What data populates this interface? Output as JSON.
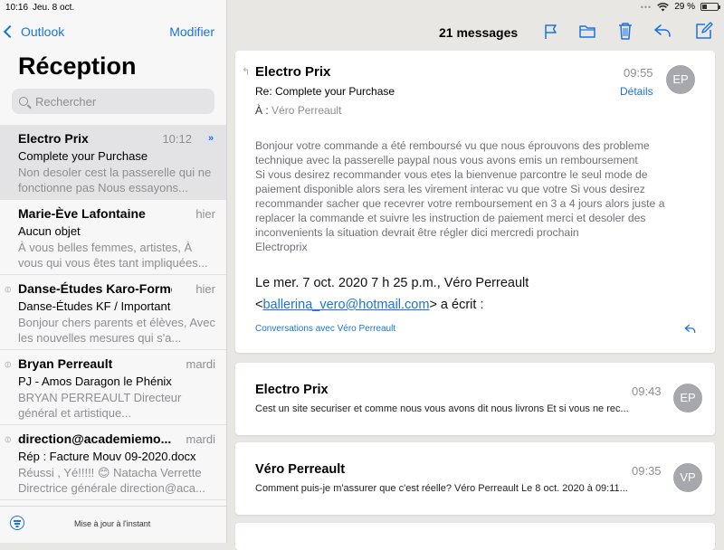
{
  "status_bar": {
    "time": "10:16",
    "date": "Jeu. 8 oct.",
    "battery": "29 %",
    "battery_fraction": 0.29
  },
  "sidebar": {
    "back_label": "Outlook",
    "edit_label": "Modifier",
    "title": "Réception",
    "search_placeholder": "Rechercher",
    "items": [
      {
        "sender": "Electro Prix",
        "time": "10:12",
        "subject": "Complete your Purchase",
        "preview": "Non desoler cest la passerelle qui ne fonctionne pas Nous essayons...",
        "selected": true,
        "attachment": false
      },
      {
        "sender": "Marie-Ève Lafontaine",
        "time": "hier",
        "subject": "Aucun objet",
        "preview": "À vous belles femmes, artistes, À vous qui vous êtes tant impliquées...",
        "selected": false,
        "attachment": false
      },
      {
        "sender": "Danse-Études Karo-Forme",
        "time": "hier",
        "subject": "Danse-Études KF / Important",
        "preview": "Bonjour chers parents et élèves, Avec les nouvelles mesures qui s'a...",
        "selected": false,
        "attachment": true
      },
      {
        "sender": "Bryan Perreault",
        "time": "mardi",
        "subject": "PJ - Amos Daragon le Phénix",
        "preview": "BRYAN PERREAULT Directeur général et artistique...",
        "selected": false,
        "attachment": true
      },
      {
        "sender": "direction@academiemo...",
        "time": "mardi",
        "subject": "Rép : Facture Mouv 09-2020.docx",
        "preview": "Réussi , Yé!!!!! 😊 Natacha Verrette Directrice générale direction@aca...",
        "selected": false,
        "attachment": true
      }
    ],
    "footer_status": "Mise à jour à l'instant"
  },
  "toolbar": {
    "message_count": "21 messages"
  },
  "thread": {
    "main": {
      "sender": "Electro Prix",
      "time": "09:55",
      "subject": "Re: Complete your Purchase",
      "details_label": "Détails",
      "to_label": "À :",
      "to_value": "Véro Perreault",
      "avatar": "EP",
      "body_lines": [
        "Bonjour votre commande a été  remboursé vu que nous éprouvons des probleme",
        "technique avec la passerelle paypal nous vous avons emis un remboursement",
        "Si vous desirez recommander vous etes la bienvenue parcontre le seul mode de",
        "paiement disponible alors sera les virement interac vu que votre Si vous desirez",
        "recommander sacher que recevrer votre remboursement en 3 a 4 jours alors juste a",
        "replacer la commande et suivre les instruction de paiement merci et desoler des",
        "inconvenients la situation devrait être régler dici mercredi prochain",
        "Electroprix"
      ],
      "quote_line1": "Le mer. 7 oct. 2020 7 h 25 p.m., Véro Perreault",
      "quote_open": "<",
      "quote_email": "ballerina_vero@hotmail.com",
      "quote_close": "> a écrit :",
      "conversations_label": "Conversations avec Véro Perreault"
    },
    "others": [
      {
        "sender": "Electro Prix",
        "time": "09:43",
        "avatar": "EP",
        "preview": "Cest un site securiser et comme nous vous avons dit nous livrons Et si vous ne rec..."
      },
      {
        "sender": "Véro Perreault",
        "time": "09:35",
        "avatar": "VP",
        "preview": "Comment puis-je m'assurer que c'est réelle? Véro Perreault Le 8 oct. 2020 à 09:11..."
      }
    ]
  },
  "colors": {
    "accent": "#1a73d9",
    "avatar": "#a7a8ad"
  }
}
